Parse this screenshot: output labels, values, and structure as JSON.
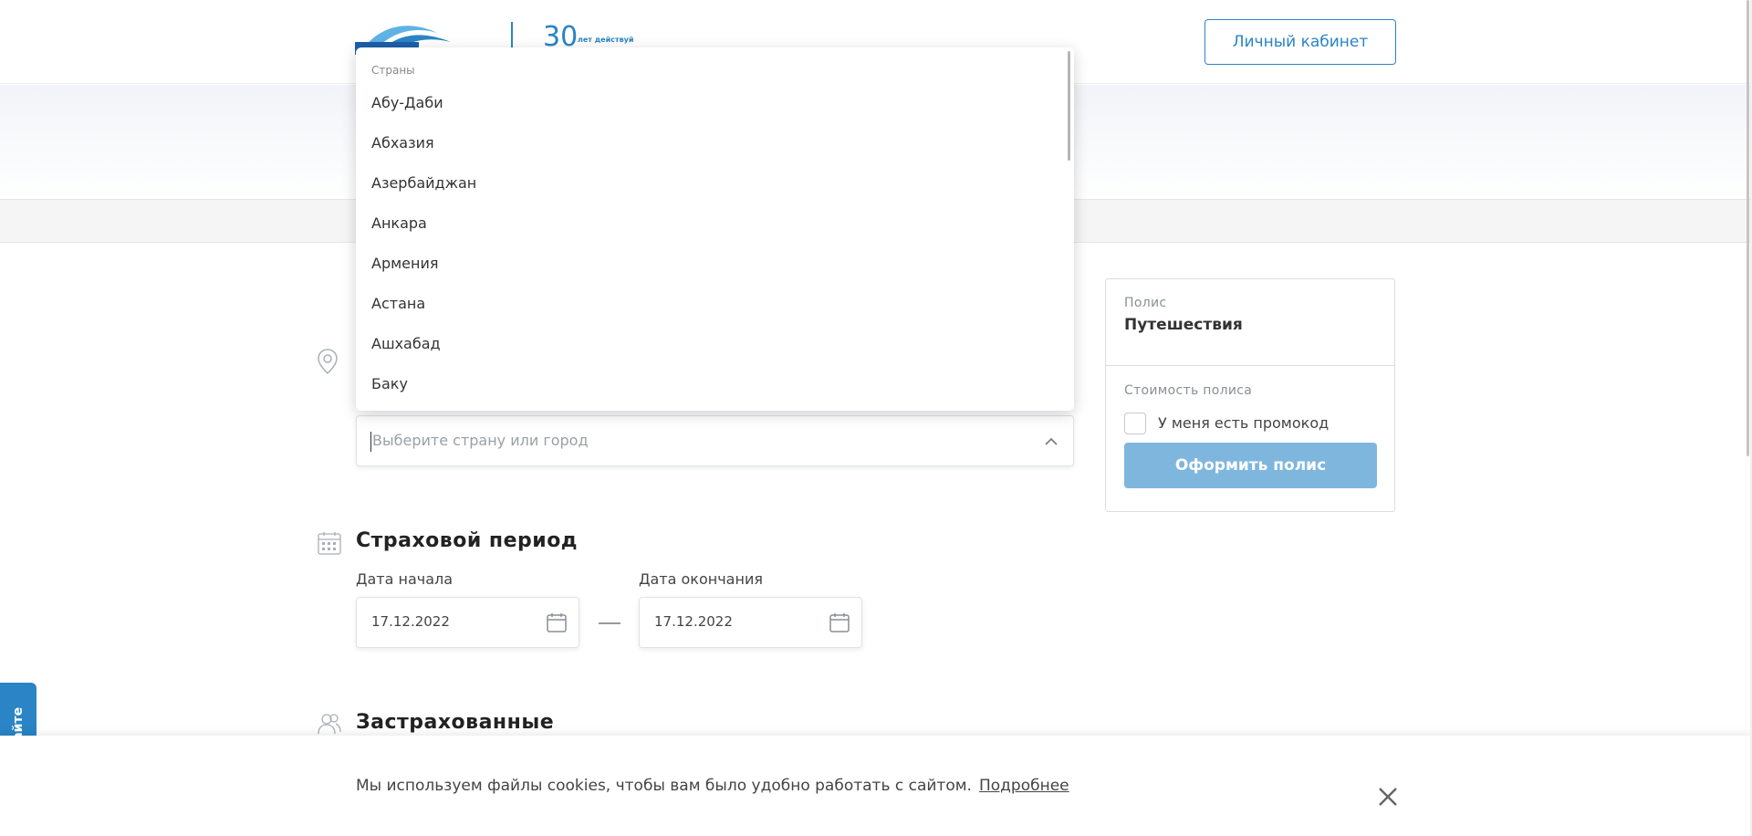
{
  "header": {
    "cabinet_button": "Личный кабинет",
    "logo_anniversary_text": "лет действуй"
  },
  "destination": {
    "placeholder": "Выберите страну или город",
    "dropdown": {
      "group_label": "Страны",
      "options": [
        "Абу-Даби",
        "Абхазия",
        "Азербайджан",
        "Анкара",
        "Армения",
        "Астана",
        "Ашхабад",
        "Баку"
      ]
    }
  },
  "period": {
    "title": "Страховой период",
    "start_label": "Дата начала",
    "start_value": "17.12.2022",
    "end_label": "Дата окончания",
    "end_value": "17.12.2022"
  },
  "insured": {
    "title": "Застрахованные"
  },
  "policy_panel": {
    "policy_label": "Полис",
    "policy_type": "Путешествия",
    "cost_label": "Стоимость полиса",
    "promo_label": "У меня есть промокод",
    "order_button": "Оформить полис"
  },
  "feedback_tab": "Отзыв о сайте",
  "cookie": {
    "text": "Мы используем файлы cookies, чтобы вам было удобно работать с сайтом.",
    "link": "Подробнее"
  },
  "colors": {
    "brand_blue": "#2a84c5",
    "button_disabled": "#7fb6de"
  }
}
